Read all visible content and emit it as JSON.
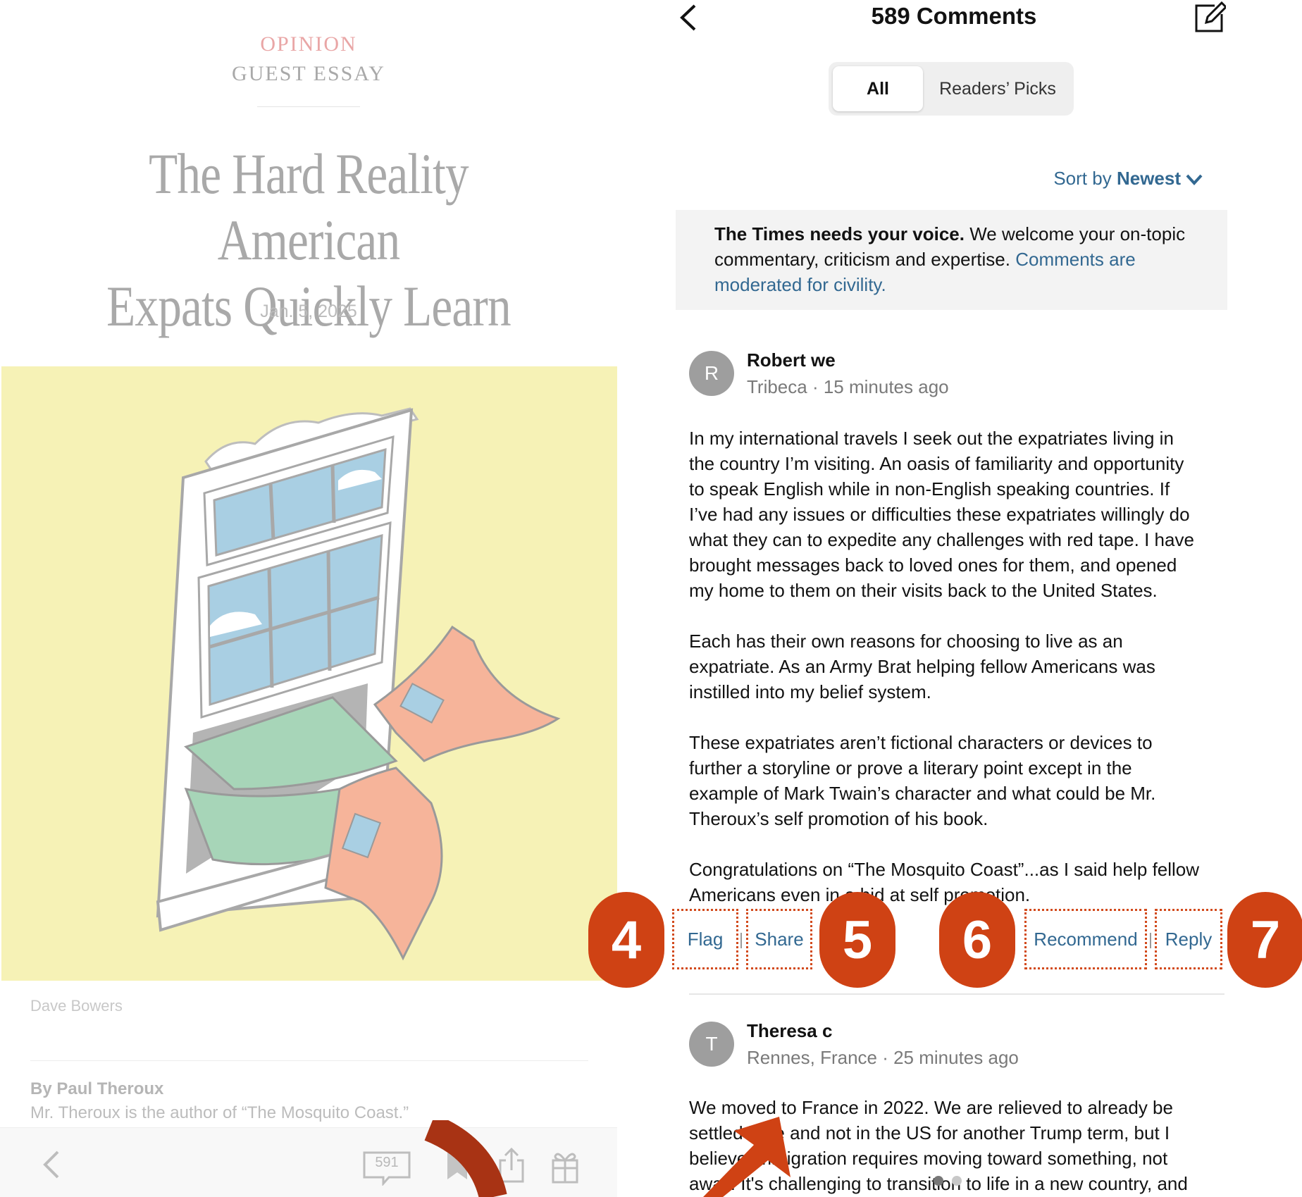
{
  "article": {
    "kicker_section": "OPINION",
    "kicker_type": "GUEST ESSAY",
    "headline_line1": "The Hard Reality American",
    "headline_line2": "Expats Quickly Learn",
    "date": "Jan. 5, 2025",
    "image_credit": "Dave Bowers",
    "byline": "By Paul Theroux",
    "author_bio": "Mr. Theroux is the author of “The Mosquito Coast.”"
  },
  "toolbar": {
    "comment_count": "591",
    "icons": [
      "back-icon",
      "comments-icon",
      "bookmark-icon",
      "share-icon",
      "gift-icon"
    ]
  },
  "comments_header": {
    "title": "589 Comments",
    "tabs": [
      {
        "label": "All",
        "selected": true
      },
      {
        "label": "Readers’ Picks",
        "selected": false
      }
    ],
    "sort_prefix": "Sort by",
    "sort_value": "Newest"
  },
  "notice": {
    "strong": "The Times needs your voice.",
    "text": " We welcome your on-topic commentary, criticism and expertise. ",
    "link": "Comments are moderated for civility."
  },
  "comments": [
    {
      "initial": "R",
      "name": "Robert we",
      "meta": "Tribeca · 15 minutes ago",
      "paragraphs": [
        [
          "In my international travels I seek out the expatriates living in",
          "the country I’m visiting. An oasis of familiarity and opportunity",
          "to speak English while in non-English speaking countries. If",
          "I’ve had any issues or difficulties these expatriates willingly do",
          "what they can to expedite any challenges with red tape. I have",
          "brought messages back to loved ones for them, and opened",
          "my home to them on their visits back to the United States."
        ],
        [
          "Each has their own reasons for choosing to live as an",
          "expatriate. As an Army Brat helping fellow Americans was",
          "instilled into my belief system."
        ],
        [
          "These expatriates aren’t fictional characters or devices to",
          "further a storyline or prove a literary point except in the",
          "example of Mark Twain’s character and what could be Mr.",
          "Theroux’s self promotion of his book."
        ],
        [
          "Congratulations on “The Mosquito Coast”...as I said help fellow",
          "Americans even in a bid at self promotion."
        ]
      ]
    },
    {
      "initial": "T",
      "name": "Theresa c",
      "meta": "Rennes, France · 25 minutes ago",
      "paragraphs": [
        [
          "We moved to France in 2022. We are relieved to already be",
          "settled here and not in the US for another Trump term, but I",
          "believe immigration requires moving toward something, not",
          "away. It's challenging to transition to life in a new country, and"
        ]
      ]
    }
  ],
  "actions": {
    "flag": "Flag",
    "share": "Share",
    "recommend": "Recommend",
    "reply": "Reply"
  },
  "badges": [
    "4",
    "5",
    "6",
    "7"
  ],
  "colors": {
    "link": "#326891",
    "badge": "#cf4214",
    "highlight_border": "#d24a1c",
    "illustration_bg": "#f6f2b6"
  }
}
